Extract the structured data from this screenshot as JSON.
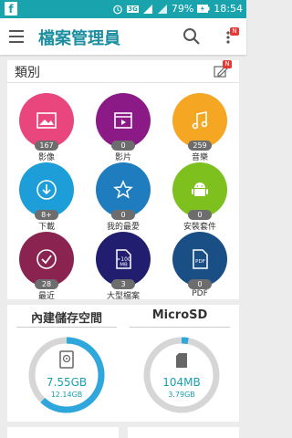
{
  "status_bar": {
    "battery_percent": "79%",
    "time": "18:54",
    "network": "3G"
  },
  "app_bar": {
    "title": "檔案管理員",
    "menu_badge": "N"
  },
  "categories": {
    "header": "類別",
    "edit_badge": "N",
    "items": [
      {
        "label": "影像",
        "count": "167",
        "color": "#e8467c",
        "icon": "image-icon"
      },
      {
        "label": "影片",
        "count": "0",
        "color": "#8b1a86",
        "icon": "video-icon"
      },
      {
        "label": "音樂",
        "count": "259",
        "color": "#f5a623",
        "icon": "music-icon"
      },
      {
        "label": "下載",
        "count": "8+",
        "color": "#1e9ed8",
        "icon": "download-icon"
      },
      {
        "label": "我的最愛",
        "count": "0",
        "color": "#1f7dbf",
        "icon": "star-icon"
      },
      {
        "label": "安裝套件",
        "count": "0",
        "color": "#7ec01e",
        "icon": "android-icon"
      },
      {
        "label": "最近",
        "count": "28",
        "color": "#8a2350",
        "icon": "recent-icon"
      },
      {
        "label": "大型檔案",
        "count": "3",
        "color": "#211e70",
        "icon": "large-file-icon"
      },
      {
        "label": "PDF",
        "count": "0",
        "color": "#1a4f86",
        "icon": "pdf-icon"
      }
    ]
  },
  "storage": {
    "internal": {
      "title": "內建儲存空間",
      "used": "7.55GB",
      "total": "12.14GB",
      "used_fraction": 0.62
    },
    "sd": {
      "title": "MicroSD",
      "used": "104MB",
      "total": "3.79GB",
      "used_fraction": 0.03
    }
  },
  "colors": {
    "accent": "#18a3ad",
    "ring_used": "#2ea7dc",
    "ring_free": "#d6d6d6"
  }
}
